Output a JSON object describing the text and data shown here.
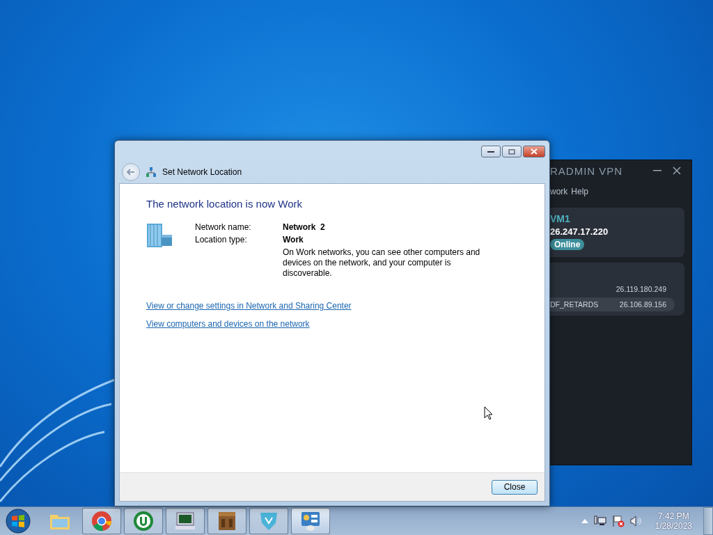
{
  "vpn_window": {
    "title": "RADMIN VPN",
    "menu": [
      "work",
      "Help"
    ],
    "network": {
      "name": "VM1",
      "ip": "26.247.17.220",
      "status": "Online"
    },
    "peers": [
      {
        "ip": "26.119.180.249",
        "selected": false
      },
      {
        "name": "DF_RETARDS",
        "ip": "26.106.89.156",
        "selected": true
      }
    ]
  },
  "dialog": {
    "title": "Set Network Location",
    "heading": "The network location is now Work",
    "fields": [
      {
        "label": "Network name:",
        "value": "Network  2"
      },
      {
        "label": "Location type:",
        "value": "Work"
      }
    ],
    "description": "On Work networks, you can see other computers and devices on the network, and your computer is discoverable.",
    "links": [
      "View or change settings in Network and Sharing Center",
      "View computers and devices on the network"
    ],
    "button": "Close"
  },
  "taskbar": {
    "apps": [
      {
        "kind": "folder",
        "running": false,
        "selected": false
      },
      {
        "kind": "browser",
        "running": true,
        "selected": false
      },
      {
        "kind": "torrent",
        "running": true,
        "selected": false
      },
      {
        "kind": "monitor",
        "running": true,
        "selected": false
      },
      {
        "kind": "crate",
        "running": true,
        "selected": false
      },
      {
        "kind": "vpn",
        "running": true,
        "selected": false
      },
      {
        "kind": "panel",
        "running": true,
        "selected": true
      }
    ],
    "time": "7:42 PM",
    "date": "1/28/2023"
  }
}
